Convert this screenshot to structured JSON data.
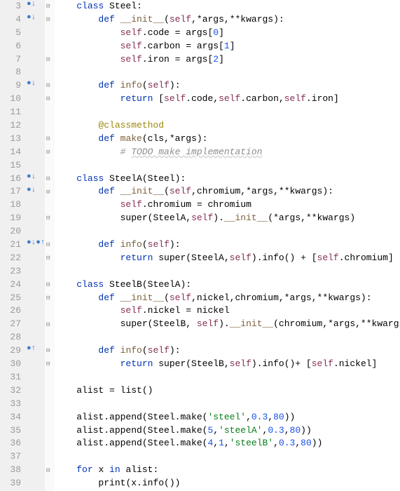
{
  "lines": [
    {
      "num": 3,
      "marker": "●↓",
      "fold": "⊟",
      "tokens": [
        {
          "cls": "kw",
          "t": "class "
        },
        {
          "cls": "cls",
          "t": "Steel:"
        }
      ]
    },
    {
      "num": 4,
      "marker": "●↓",
      "fold": "⊟",
      "indent": 1,
      "tokens": [
        {
          "cls": "kw",
          "t": "def "
        },
        {
          "cls": "fn",
          "t": "__init__"
        },
        {
          "cls": "op",
          "t": "("
        },
        {
          "cls": "self",
          "t": "self"
        },
        {
          "cls": "op",
          "t": ",*args,**kwargs):"
        }
      ]
    },
    {
      "num": 5,
      "marker": "",
      "fold": "",
      "indent": 2,
      "tokens": [
        {
          "cls": "self",
          "t": "self"
        },
        {
          "cls": "op",
          "t": ".code = args["
        },
        {
          "cls": "num",
          "t": "0"
        },
        {
          "cls": "op",
          "t": "]"
        }
      ]
    },
    {
      "num": 6,
      "marker": "",
      "fold": "",
      "indent": 2,
      "tokens": [
        {
          "cls": "self",
          "t": "self"
        },
        {
          "cls": "op",
          "t": ".carbon = args["
        },
        {
          "cls": "num",
          "t": "1"
        },
        {
          "cls": "op",
          "t": "]"
        }
      ]
    },
    {
      "num": 7,
      "marker": "",
      "fold": "⊟",
      "indent": 2,
      "tokens": [
        {
          "cls": "self",
          "t": "self"
        },
        {
          "cls": "op",
          "t": ".iron = args["
        },
        {
          "cls": "num",
          "t": "2"
        },
        {
          "cls": "op",
          "t": "]"
        }
      ]
    },
    {
      "num": 8,
      "marker": "",
      "fold": "",
      "indent": 0,
      "tokens": []
    },
    {
      "num": 9,
      "marker": "●↓",
      "fold": "⊟",
      "indent": 1,
      "tokens": [
        {
          "cls": "kw",
          "t": "def "
        },
        {
          "cls": "fn",
          "t": "info"
        },
        {
          "cls": "op",
          "t": "("
        },
        {
          "cls": "self",
          "t": "self"
        },
        {
          "cls": "op",
          "t": "):"
        }
      ]
    },
    {
      "num": 10,
      "marker": "",
      "fold": "⊟",
      "indent": 2,
      "tokens": [
        {
          "cls": "kw",
          "t": "return "
        },
        {
          "cls": "op",
          "t": "["
        },
        {
          "cls": "self",
          "t": "self"
        },
        {
          "cls": "op",
          "t": ".code,"
        },
        {
          "cls": "self",
          "t": "self"
        },
        {
          "cls": "op",
          "t": ".carbon,"
        },
        {
          "cls": "self",
          "t": "self"
        },
        {
          "cls": "op",
          "t": ".iron]"
        }
      ]
    },
    {
      "num": 11,
      "marker": "",
      "fold": "",
      "indent": 0,
      "tokens": []
    },
    {
      "num": 12,
      "marker": "",
      "fold": "",
      "indent": 1,
      "tokens": [
        {
          "cls": "dec",
          "t": "@classmethod"
        }
      ]
    },
    {
      "num": 13,
      "marker": "",
      "fold": "⊟",
      "indent": 1,
      "tokens": [
        {
          "cls": "kw",
          "t": "def "
        },
        {
          "cls": "fn",
          "t": "make"
        },
        {
          "cls": "op",
          "t": "(cls,*args):"
        }
      ]
    },
    {
      "num": 14,
      "marker": "",
      "fold": "⊟",
      "indent": 2,
      "tokens": [
        {
          "cls": "cmt",
          "t": "# "
        },
        {
          "cls": "cmt cmt-u",
          "t": "TODO make implementation"
        }
      ]
    },
    {
      "num": 15,
      "marker": "",
      "fold": "",
      "indent": 0,
      "tokens": []
    },
    {
      "num": 16,
      "marker": "●↓",
      "fold": "⊟",
      "indent": 0,
      "tokens": [
        {
          "cls": "kw",
          "t": "class "
        },
        {
          "cls": "cls",
          "t": "SteelA(Steel):"
        }
      ]
    },
    {
      "num": 17,
      "marker": "●↓",
      "fold": "⊟",
      "indent": 1,
      "tokens": [
        {
          "cls": "kw",
          "t": "def "
        },
        {
          "cls": "fn",
          "t": "__init__"
        },
        {
          "cls": "op",
          "t": "("
        },
        {
          "cls": "self",
          "t": "self"
        },
        {
          "cls": "op",
          "t": ",chromium,*args,**kwargs):"
        }
      ]
    },
    {
      "num": 18,
      "marker": "",
      "fold": "",
      "indent": 2,
      "tokens": [
        {
          "cls": "self",
          "t": "self"
        },
        {
          "cls": "op",
          "t": ".chromium = chromium"
        }
      ]
    },
    {
      "num": 19,
      "marker": "",
      "fold": "⊟",
      "indent": 2,
      "tokens": [
        {
          "cls": "builtin",
          "t": "super"
        },
        {
          "cls": "op",
          "t": "(SteelA,"
        },
        {
          "cls": "self",
          "t": "self"
        },
        {
          "cls": "op",
          "t": ")."
        },
        {
          "cls": "fn",
          "t": "__init__"
        },
        {
          "cls": "op",
          "t": "(*args,**kwargs)"
        }
      ]
    },
    {
      "num": 20,
      "marker": "",
      "fold": "",
      "indent": 0,
      "tokens": []
    },
    {
      "num": 21,
      "marker": "●↓●↑",
      "fold": "⊟",
      "indent": 1,
      "tokens": [
        {
          "cls": "kw",
          "t": "def "
        },
        {
          "cls": "fn",
          "t": "info"
        },
        {
          "cls": "op",
          "t": "("
        },
        {
          "cls": "self",
          "t": "self"
        },
        {
          "cls": "op",
          "t": "):"
        }
      ]
    },
    {
      "num": 22,
      "marker": "",
      "fold": "⊟",
      "indent": 2,
      "tokens": [
        {
          "cls": "kw",
          "t": "return "
        },
        {
          "cls": "builtin",
          "t": "super"
        },
        {
          "cls": "op",
          "t": "(SteelA,"
        },
        {
          "cls": "self",
          "t": "self"
        },
        {
          "cls": "op",
          "t": ").info() + ["
        },
        {
          "cls": "self",
          "t": "self"
        },
        {
          "cls": "op",
          "t": ".chromium]"
        }
      ]
    },
    {
      "num": 23,
      "marker": "",
      "fold": "",
      "indent": 0,
      "tokens": []
    },
    {
      "num": 24,
      "marker": "",
      "fold": "⊟",
      "indent": 0,
      "tokens": [
        {
          "cls": "kw",
          "t": "class "
        },
        {
          "cls": "cls",
          "t": "SteelB(SteelA):"
        }
      ]
    },
    {
      "num": 25,
      "marker": "",
      "fold": "⊟",
      "indent": 1,
      "tokens": [
        {
          "cls": "kw",
          "t": "def "
        },
        {
          "cls": "fn",
          "t": "__init__"
        },
        {
          "cls": "op",
          "t": "("
        },
        {
          "cls": "self",
          "t": "self"
        },
        {
          "cls": "op",
          "t": ",nickel,chromium,*args,**kwargs):"
        }
      ]
    },
    {
      "num": 26,
      "marker": "",
      "fold": "",
      "indent": 2,
      "tokens": [
        {
          "cls": "self",
          "t": "self"
        },
        {
          "cls": "op",
          "t": ".nickel = nickel"
        }
      ]
    },
    {
      "num": 27,
      "marker": "",
      "fold": "⊟",
      "indent": 2,
      "tokens": [
        {
          "cls": "builtin",
          "t": "super"
        },
        {
          "cls": "op",
          "t": "(SteelB, "
        },
        {
          "cls": "self",
          "t": "self"
        },
        {
          "cls": "op",
          "t": ")."
        },
        {
          "cls": "fn",
          "t": "__init__"
        },
        {
          "cls": "op",
          "t": "(chromium,*args,**kwargs)"
        }
      ]
    },
    {
      "num": 28,
      "marker": "",
      "fold": "",
      "indent": 0,
      "tokens": []
    },
    {
      "num": 29,
      "marker": "●↑",
      "fold": "⊟",
      "indent": 1,
      "tokens": [
        {
          "cls": "kw",
          "t": "def "
        },
        {
          "cls": "fn",
          "t": "info"
        },
        {
          "cls": "op",
          "t": "("
        },
        {
          "cls": "self",
          "t": "self"
        },
        {
          "cls": "op",
          "t": "):"
        }
      ]
    },
    {
      "num": 30,
      "marker": "",
      "fold": "⊟",
      "indent": 2,
      "tokens": [
        {
          "cls": "kw",
          "t": "return "
        },
        {
          "cls": "builtin",
          "t": "super"
        },
        {
          "cls": "op",
          "t": "(SteelB,"
        },
        {
          "cls": "self",
          "t": "self"
        },
        {
          "cls": "op",
          "t": ").info()+ ["
        },
        {
          "cls": "self",
          "t": "self"
        },
        {
          "cls": "op",
          "t": ".nickel]"
        }
      ]
    },
    {
      "num": 31,
      "marker": "",
      "fold": "",
      "indent": 0,
      "tokens": []
    },
    {
      "num": 32,
      "marker": "",
      "fold": "",
      "indent": 0,
      "tokens": [
        {
          "cls": "ident",
          "t": "alist = "
        },
        {
          "cls": "builtin",
          "t": "list"
        },
        {
          "cls": "op",
          "t": "()"
        }
      ]
    },
    {
      "num": 33,
      "marker": "",
      "fold": "",
      "indent": 0,
      "tokens": []
    },
    {
      "num": 34,
      "marker": "",
      "fold": "",
      "indent": 0,
      "tokens": [
        {
          "cls": "ident",
          "t": "alist.append(Steel.make("
        },
        {
          "cls": "str",
          "t": "'steel'"
        },
        {
          "cls": "op",
          "t": ","
        },
        {
          "cls": "num",
          "t": "0.3"
        },
        {
          "cls": "op",
          "t": ","
        },
        {
          "cls": "num",
          "t": "80"
        },
        {
          "cls": "op",
          "t": "))"
        }
      ]
    },
    {
      "num": 35,
      "marker": "",
      "fold": "",
      "indent": 0,
      "tokens": [
        {
          "cls": "ident",
          "t": "alist.append(Steel.make("
        },
        {
          "cls": "num",
          "t": "5"
        },
        {
          "cls": "op",
          "t": ","
        },
        {
          "cls": "str",
          "t": "'steelA'"
        },
        {
          "cls": "op",
          "t": ","
        },
        {
          "cls": "num",
          "t": "0.3"
        },
        {
          "cls": "op",
          "t": ","
        },
        {
          "cls": "num",
          "t": "80"
        },
        {
          "cls": "op",
          "t": "))"
        }
      ]
    },
    {
      "num": 36,
      "marker": "",
      "fold": "",
      "indent": 0,
      "tokens": [
        {
          "cls": "ident",
          "t": "alist.append(Steel.make("
        },
        {
          "cls": "num",
          "t": "4"
        },
        {
          "cls": "op",
          "t": ","
        },
        {
          "cls": "num",
          "t": "1"
        },
        {
          "cls": "op",
          "t": ","
        },
        {
          "cls": "str",
          "t": "'steelB'"
        },
        {
          "cls": "op",
          "t": ","
        },
        {
          "cls": "num",
          "t": "0.3"
        },
        {
          "cls": "op",
          "t": ","
        },
        {
          "cls": "num",
          "t": "80"
        },
        {
          "cls": "op",
          "t": "))"
        }
      ]
    },
    {
      "num": 37,
      "marker": "",
      "fold": "",
      "indent": 0,
      "tokens": []
    },
    {
      "num": 38,
      "marker": "",
      "fold": "⊟",
      "indent": 0,
      "tokens": [
        {
          "cls": "kw",
          "t": "for "
        },
        {
          "cls": "ident",
          "t": "x "
        },
        {
          "cls": "kw",
          "t": "in "
        },
        {
          "cls": "ident",
          "t": "alist:"
        }
      ]
    },
    {
      "num": 39,
      "marker": "",
      "fold": "",
      "indent": 1,
      "tokens": [
        {
          "cls": "builtin",
          "t": "print"
        },
        {
          "cls": "op",
          "t": "(x.info())"
        }
      ]
    }
  ]
}
